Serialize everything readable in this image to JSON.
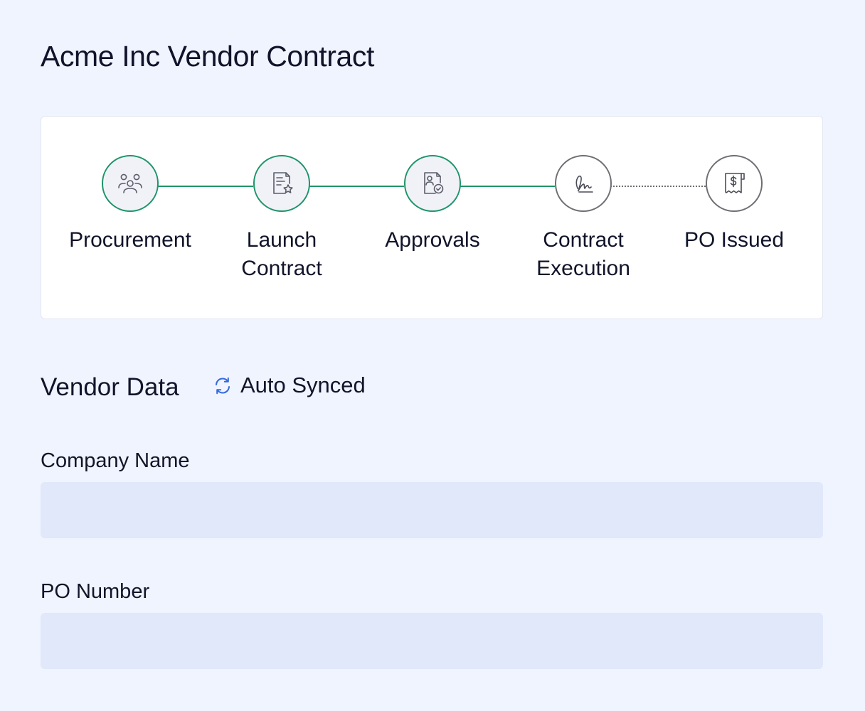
{
  "page": {
    "title": "Acme Inc Vendor Contract"
  },
  "stepper": {
    "steps": [
      {
        "label": "Procurement",
        "icon": "users-group-icon",
        "status": "complete"
      },
      {
        "label": "Launch Contract",
        "icon": "document-star-icon",
        "status": "complete"
      },
      {
        "label": "Approvals",
        "icon": "document-approval-icon",
        "status": "complete"
      },
      {
        "label": "Contract Execution",
        "icon": "signature-icon",
        "status": "pending"
      },
      {
        "label": "PO Issued",
        "icon": "receipt-dollar-icon",
        "status": "pending"
      }
    ]
  },
  "vendor_data": {
    "heading": "Vendor Data",
    "sync_status": "Auto Synced",
    "sync_icon": "sync-icon",
    "fields": [
      {
        "label": "Company Name",
        "value": "",
        "placeholder": ""
      },
      {
        "label": "PO Number",
        "value": "",
        "placeholder": ""
      }
    ]
  },
  "colors": {
    "background": "#f0f4fe",
    "card": "#ffffff",
    "complete_accent": "#1f9468",
    "pending_accent": "#6e6e74",
    "input_background": "#e0e8fa",
    "sync_icon_color": "#3569e0"
  }
}
